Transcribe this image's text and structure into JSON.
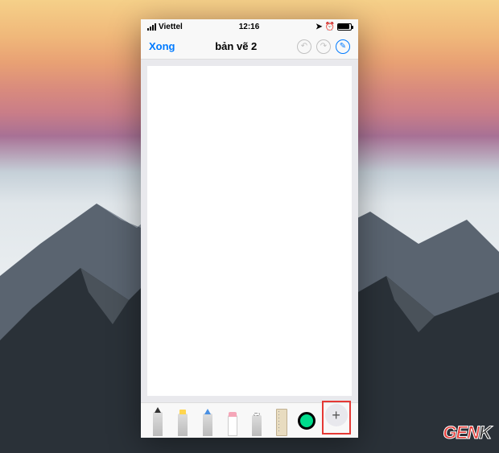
{
  "status_bar": {
    "carrier": "Viettel",
    "time": "12:16",
    "location_icon": "location",
    "alarm_icon": "alarm",
    "battery_level": "full"
  },
  "nav": {
    "done_label": "Xong",
    "title": "bản vẽ 2",
    "undo_icon": "undo",
    "redo_icon": "redo",
    "markup_icon": "markup"
  },
  "toolbar": {
    "tools": [
      {
        "name": "pen",
        "label": "Pen"
      },
      {
        "name": "highlighter",
        "label": "Highlighter"
      },
      {
        "name": "pencil",
        "label": "Pencil"
      },
      {
        "name": "eraser",
        "label": "Eraser"
      },
      {
        "name": "lasso",
        "label": "Lasso"
      },
      {
        "name": "ruler",
        "label": "Ruler"
      }
    ],
    "current_color": "#00dc8c",
    "add_label": "+"
  },
  "watermark": {
    "part1": "GEN",
    "part2": "K"
  }
}
